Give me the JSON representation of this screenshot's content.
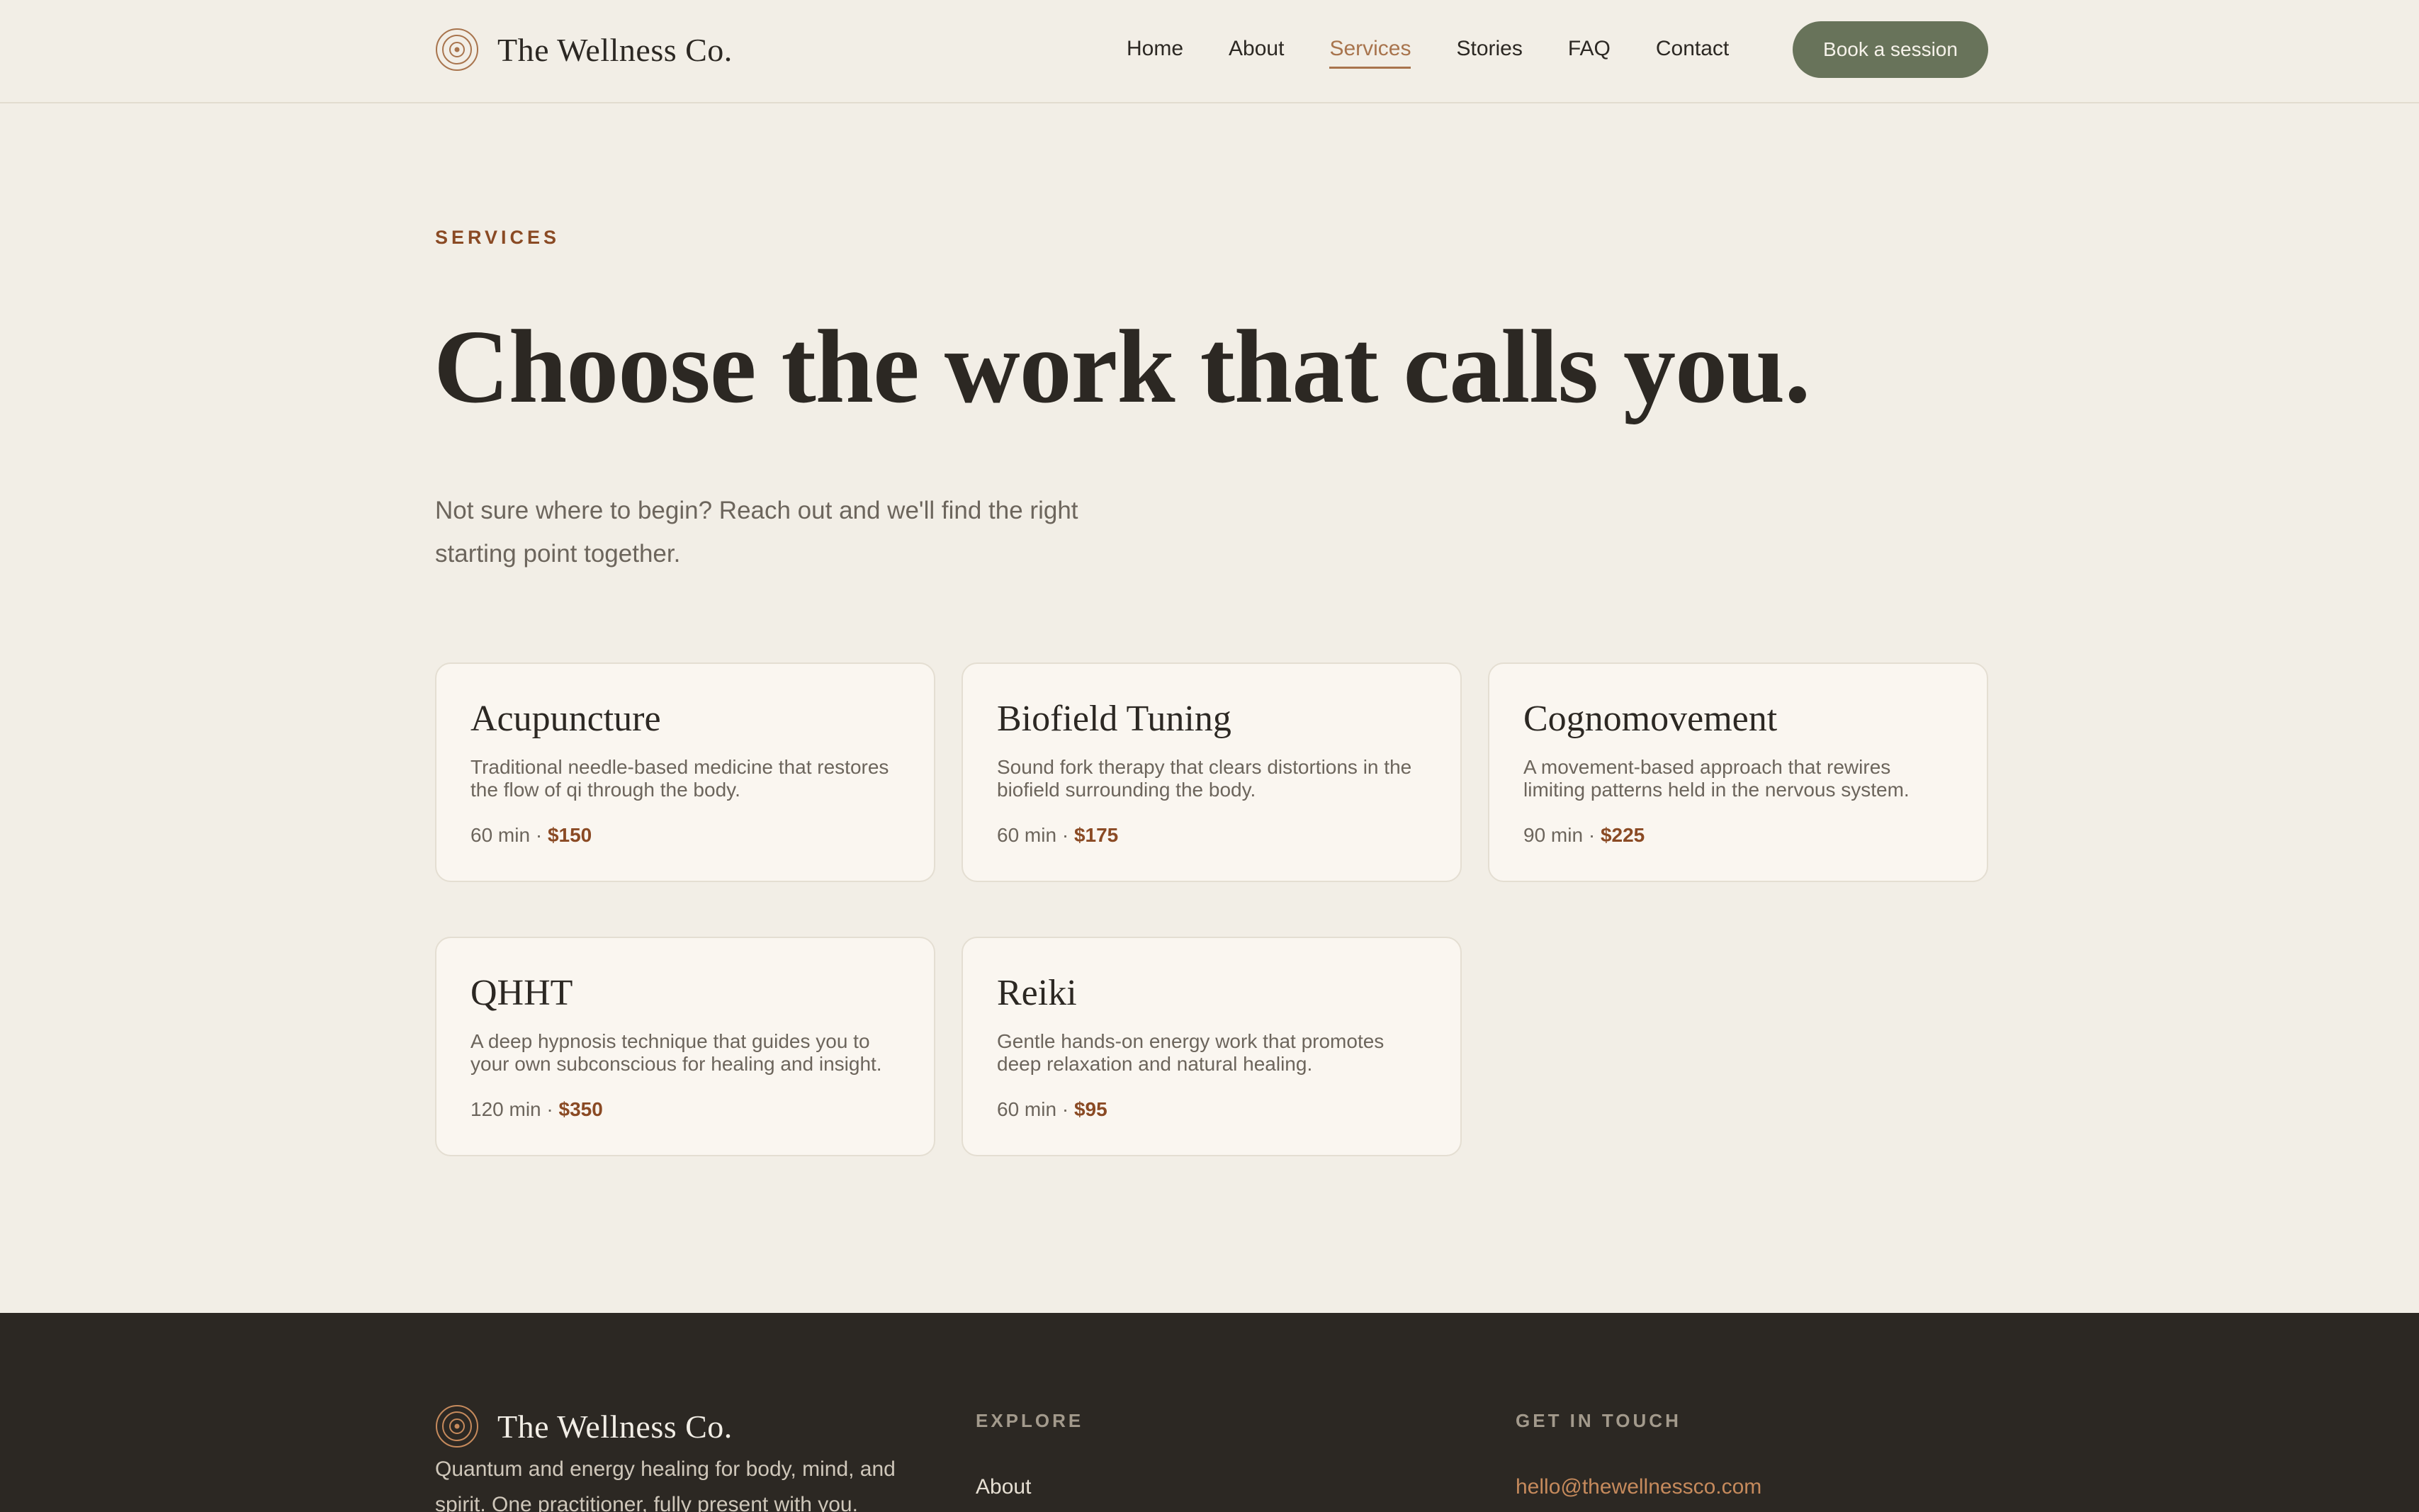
{
  "header": {
    "brand": "The Wellness Co.",
    "nav": [
      "Home",
      "About",
      "Services",
      "Stories",
      "FAQ",
      "Contact"
    ],
    "active_nav": "Services",
    "cta": "Book a session"
  },
  "hero": {
    "eyebrow": "SERVICES",
    "title": "Choose the work that calls you.",
    "subtitle": "Not sure where to begin? Reach out and we'll find the right starting point together."
  },
  "services": [
    {
      "name": "Acupuncture",
      "description": "Traditional needle-based medicine that restores the flow of qi through the body.",
      "duration": "60 min",
      "price": "$150"
    },
    {
      "name": "Biofield Tuning",
      "description": "Sound fork therapy that clears distortions in the biofield surrounding the body.",
      "duration": "60 min",
      "price": "$175"
    },
    {
      "name": "Cognomovement",
      "description": "A movement-based approach that rewires limiting patterns held in the nervous system.",
      "duration": "90 min",
      "price": "$225"
    },
    {
      "name": "QHHT",
      "description": "A deep hypnosis technique that guides you to your own subconscious for healing and insight.",
      "duration": "120 min",
      "price": "$350"
    },
    {
      "name": "Reiki",
      "description": "Gentle hands-on energy work that promotes deep relaxation and natural healing.",
      "duration": "60 min",
      "price": "$95"
    }
  ],
  "meta_separator": " · ",
  "footer": {
    "brand": "The Wellness Co.",
    "tagline": "Quantum and energy healing for body, mind, and spirit. One practitioner, fully present with you.",
    "explore_heading": "EXPLORE",
    "explore_first_link": "About",
    "contact_heading": "GET IN TOUCH",
    "email": "hello@thewellnessco.com"
  },
  "colors": {
    "background": "#f2eee6",
    "accent": "#8a4a24",
    "active_nav": "#a8744d",
    "button": "#68735a",
    "footer": "#2c2823"
  },
  "icons": {
    "logo": "concentric-circles-icon"
  }
}
